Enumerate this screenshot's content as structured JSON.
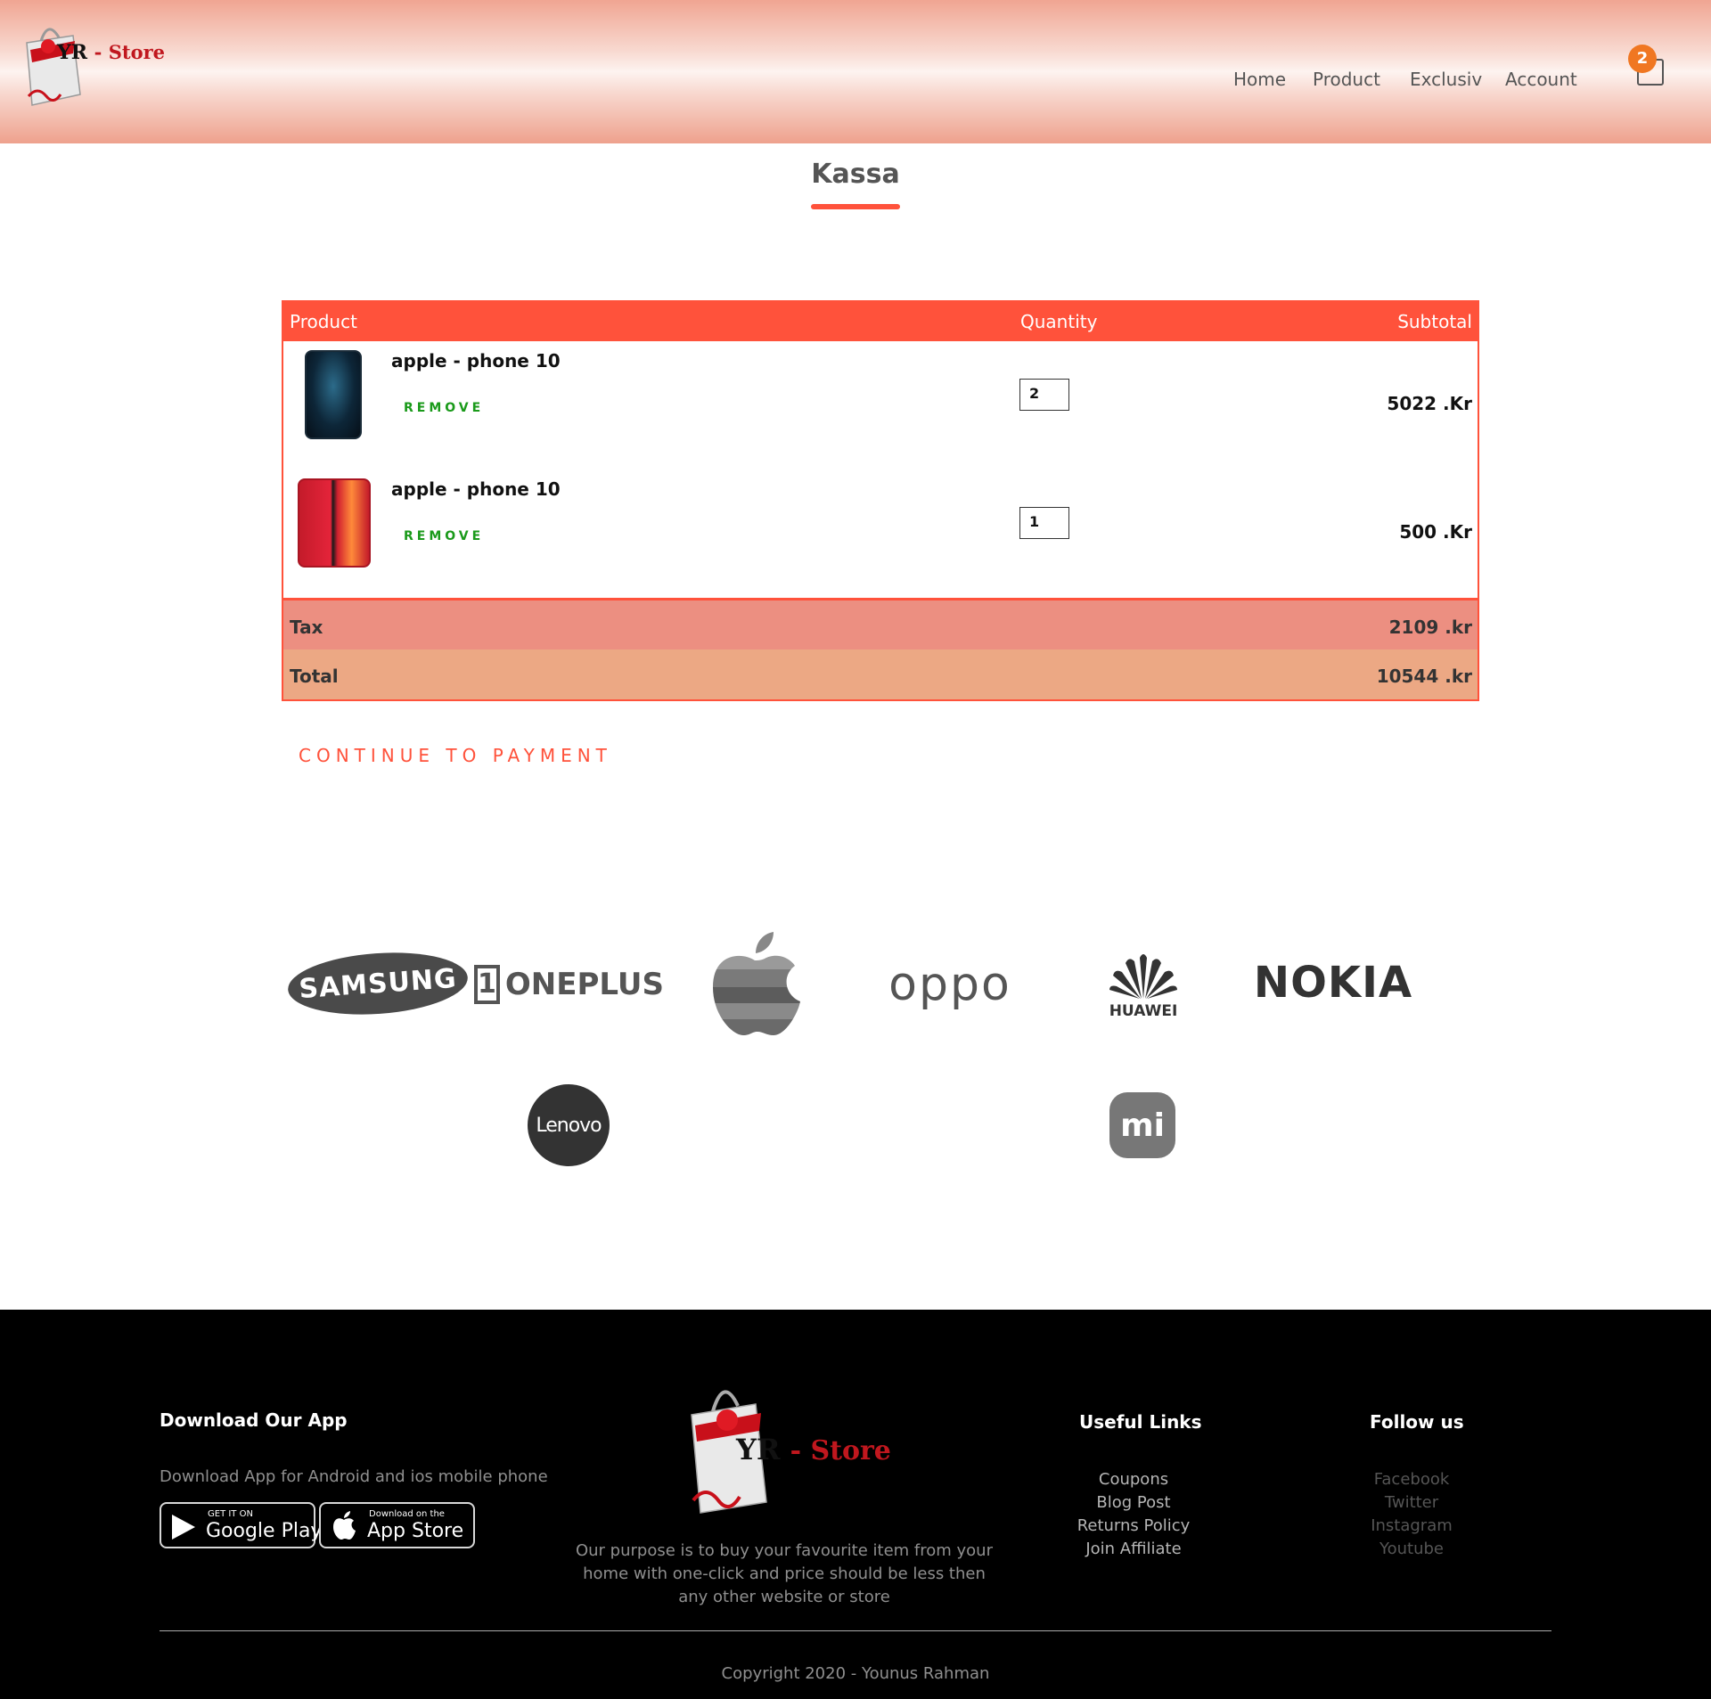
{
  "header": {
    "logo_text": "YR",
    "logo_store": "- Store",
    "nav": [
      "Home",
      "Product",
      "Exclusiv",
      "Account"
    ],
    "cart_count": "2"
  },
  "page": {
    "title": "Kassa"
  },
  "cart": {
    "columns": {
      "product": "Product",
      "quantity": "Quantity",
      "subtotal": "Subtotal"
    },
    "items": [
      {
        "name": "apple - phone 10",
        "remove": "REMOVE",
        "quantity": "2",
        "subtotal": "5022 .Kr",
        "image_color": "#0d2638"
      },
      {
        "name": "apple - phone 10",
        "remove": "REMOVE",
        "quantity": "1",
        "subtotal": "500 .Kr",
        "image_color": "#d2202f"
      }
    ],
    "tax_label": "Tax",
    "tax_value": "2109 .kr",
    "total_label": "Total",
    "total_value": "10544 .kr",
    "continue": "CONTINUE TO PAYMENT"
  },
  "brands": {
    "samsung": "SAMSUNG",
    "oneplus": "ONEPLUS",
    "oneplus_mark": "1",
    "oppo": "oppo",
    "huawei": "HUAWEI",
    "nokia": "NOKIA",
    "lenovo": "Lenovo",
    "mi": "mi"
  },
  "footer": {
    "download_heading": "Download Our App",
    "download_text": "Download App for Android and ios mobile phone",
    "google_small": "GET IT ON",
    "google_big": "Google Play",
    "apple_small": "Download on the",
    "apple_big": "App Store",
    "logo_text": "YR",
    "logo_store": "- Store",
    "purpose": "Our purpose is to buy your favourite item from your home with one-click and price should be less then any other website or store",
    "useful_heading": "Useful Links",
    "useful_links": [
      "Coupons",
      "Blog Post",
      "Returns Policy",
      "Join Affiliate"
    ],
    "follow_heading": "Follow us",
    "follow_links": [
      "Facebook",
      "Twitter",
      "Instagram",
      "Youtube"
    ],
    "copyright": "Copyright 2020 - Younus Rahman"
  },
  "colors": {
    "accent": "#ff523b",
    "remove": "#1a9a1a",
    "tax_bg": "#ec8f81",
    "total_bg": "#eca884",
    "badge": "#f07722"
  }
}
